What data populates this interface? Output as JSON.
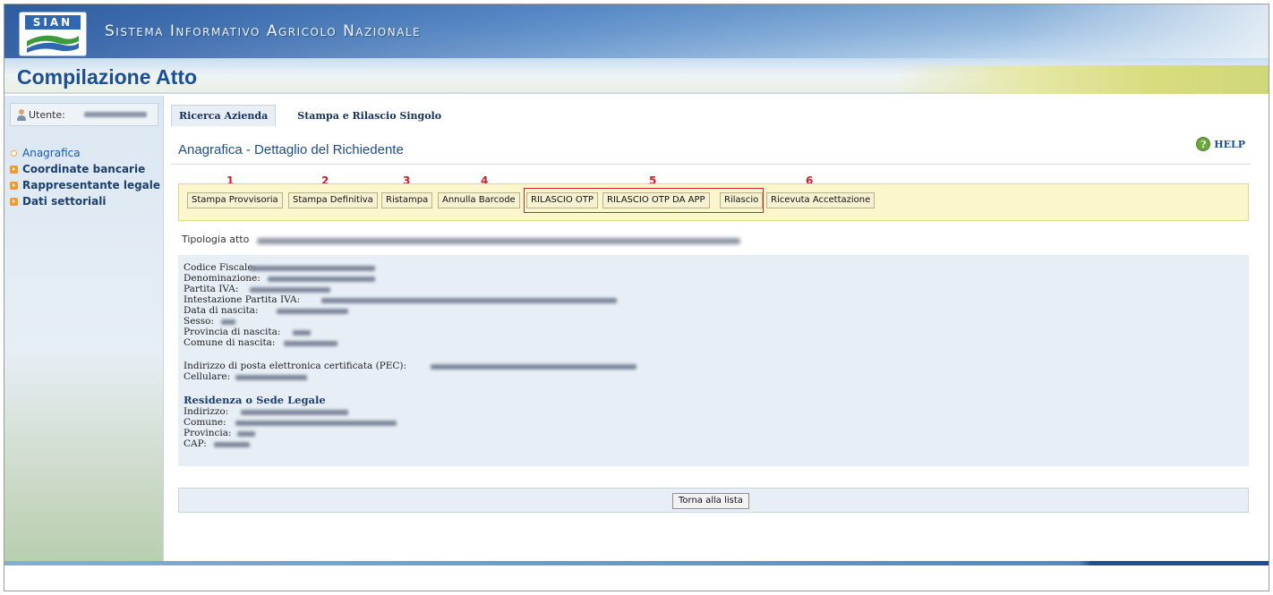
{
  "header": {
    "logo_text": "SIAN",
    "system_name": "Sistema Informativo Agricolo Nazionale",
    "title": "Compilazione Atto"
  },
  "sidebar": {
    "user_label": "Utente:",
    "items": [
      {
        "label": "Anagrafica",
        "style": "plain"
      },
      {
        "label": "Coordinate bancarie",
        "style": "box"
      },
      {
        "label": "Rappresentante legale",
        "style": "box"
      },
      {
        "label": "Dati settoriali",
        "style": "box"
      }
    ]
  },
  "tabs": [
    {
      "label": "Ricerca Azienda",
      "active": true
    },
    {
      "label": "Stampa e Rilascio Singolo",
      "active": false
    }
  ],
  "section_title": "Anagrafica - Dettaglio del Richiedente",
  "help_label": "HELP",
  "step_numbers": [
    "1",
    "2",
    "3",
    "4",
    "5",
    "6"
  ],
  "toolbar_buttons": [
    "Stampa Provvisoria",
    "Stampa Definitiva",
    "Ristampa",
    "Annulla Barcode",
    "RILASCIO OTP",
    "RILASCIO OTP DA APP",
    "Rilascio",
    "Ricevuta Accettazione"
  ],
  "tipologia_label": "Tipologia atto",
  "details": {
    "fields": [
      "Codice Fiscale:",
      "Denominazione:",
      "Partita IVA:",
      "Intestazione Partita IVA:",
      "Data di nascita:",
      "Sesso:",
      "Provincia di nascita:",
      "Comune di nascita:"
    ],
    "contact_fields": [
      "Indirizzo di posta elettronica certificata (PEC):",
      "Cellulare:"
    ],
    "residence_title": "Residenza o Sede Legale",
    "residence_fields": [
      "Indirizzo:",
      "Comune:",
      "Provincia:",
      "CAP:"
    ]
  },
  "back_button": "Torna alla lista",
  "colors": {
    "accent": "#1a4f93",
    "toolbar_bg": "#fbf6cb",
    "highlight_box": "#c52b2b",
    "step_number": "#c3222a"
  }
}
